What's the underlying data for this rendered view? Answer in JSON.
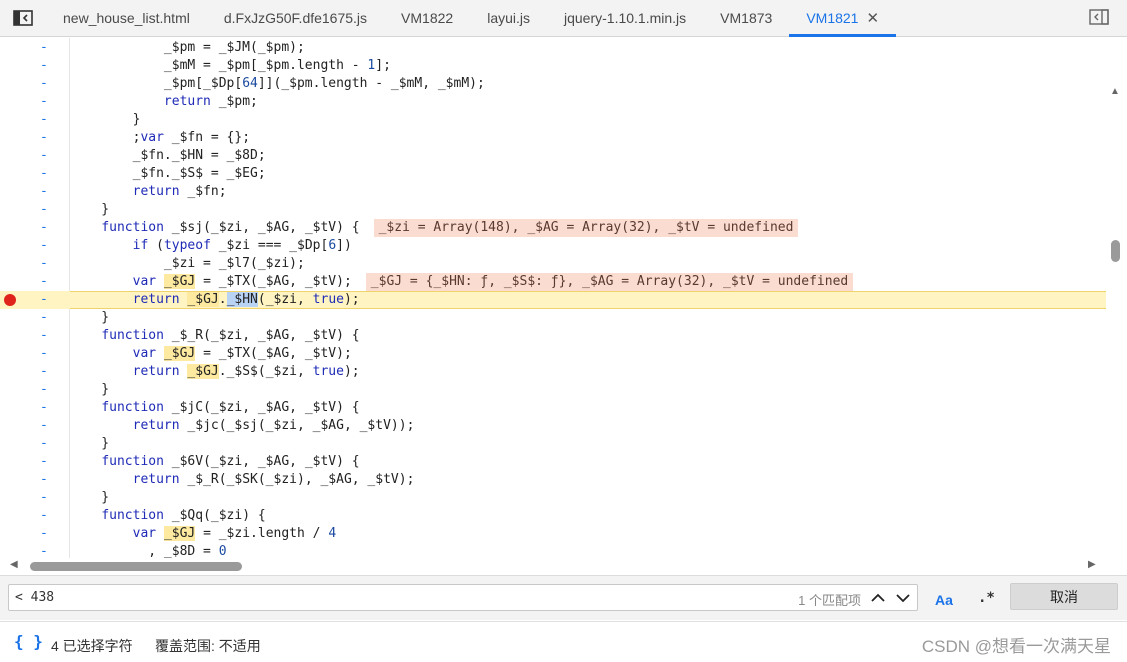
{
  "tabs": [
    {
      "label": "new_house_list.html",
      "active": false
    },
    {
      "label": "d.FxJzG50F.dfe1675.js",
      "active": false
    },
    {
      "label": "VM1822",
      "active": false
    },
    {
      "label": "layui.js",
      "active": false
    },
    {
      "label": "jquery-1.10.1.min.js",
      "active": false
    },
    {
      "label": "VM1873",
      "active": false
    },
    {
      "label": "VM1821",
      "active": true
    }
  ],
  "code_lines": [
    {
      "text": "            _$pm = _$JM(_$pm);"
    },
    {
      "text": "            _$mM = _$pm[_$pm.length - 1];"
    },
    {
      "text": "            _$pm[_$Dp[64]](_$pm.length - _$mM, _$mM);"
    },
    {
      "text": "            return _$pm;"
    },
    {
      "text": "        }"
    },
    {
      "text": "        ;var _$fn = {};"
    },
    {
      "text": "        _$fn._$HN = _$8D;"
    },
    {
      "text": "        _$fn._$S$ = _$EG;"
    },
    {
      "text": "        return _$fn;"
    },
    {
      "text": "    }"
    },
    {
      "text": "    function _$sj(_$zi, _$AG, _$tV) {",
      "inline": "_$zi = Array(148), _$AG = Array(32), _$tV = undefined"
    },
    {
      "text": "        if (typeof _$zi === _$Dp[6])"
    },
    {
      "text": "            _$zi = _$l7(_$zi);"
    },
    {
      "text": "        var _$GJ = _$TX(_$AG, _$tV);",
      "inline": "_$GJ = {_$HN: ƒ, _$S$: ƒ}, _$AG = Array(32), _$tV = undefined"
    },
    {
      "text": "        return _$GJ._$HN(_$zi, true);",
      "exec": true
    },
    {
      "text": "    }"
    },
    {
      "text": "    function _$_R(_$zi, _$AG, _$tV) {"
    },
    {
      "text": "        var _$GJ = _$TX(_$AG, _$tV);"
    },
    {
      "text": "        return _$GJ._$S$(_$zi, true);"
    },
    {
      "text": "    }"
    },
    {
      "text": "    function _$jC(_$zi, _$AG, _$tV) {"
    },
    {
      "text": "        return _$jc(_$sj(_$zi, _$AG, _$tV));"
    },
    {
      "text": "    }"
    },
    {
      "text": "    function _$6V(_$zi, _$AG, _$tV) {"
    },
    {
      "text": "        return _$_R(_$SK(_$zi), _$AG, _$tV);"
    },
    {
      "text": "    }"
    },
    {
      "text": "    function _$Qq(_$zi) {"
    },
    {
      "text": "        var _$GJ = _$zi.length / 4"
    },
    {
      "text": "          , _$8D = 0"
    }
  ],
  "gutter_dash": "-",
  "search": {
    "query": "< 438",
    "match_count": "1 个匹配项",
    "opt_case": "Aa",
    "opt_regex": ".*",
    "cancel_label": "取消"
  },
  "status": {
    "braces": "{ }",
    "selection": "4 已选择字符",
    "coverage": "覆盖范围: 不适用",
    "watermark": "CSDN @想看一次满天星"
  },
  "colors": {
    "accent": "#1a73e8",
    "exec_line": "#fff4c2",
    "inline_value_bg": "#fbdcd0",
    "breakpoint": "#e0241c"
  }
}
